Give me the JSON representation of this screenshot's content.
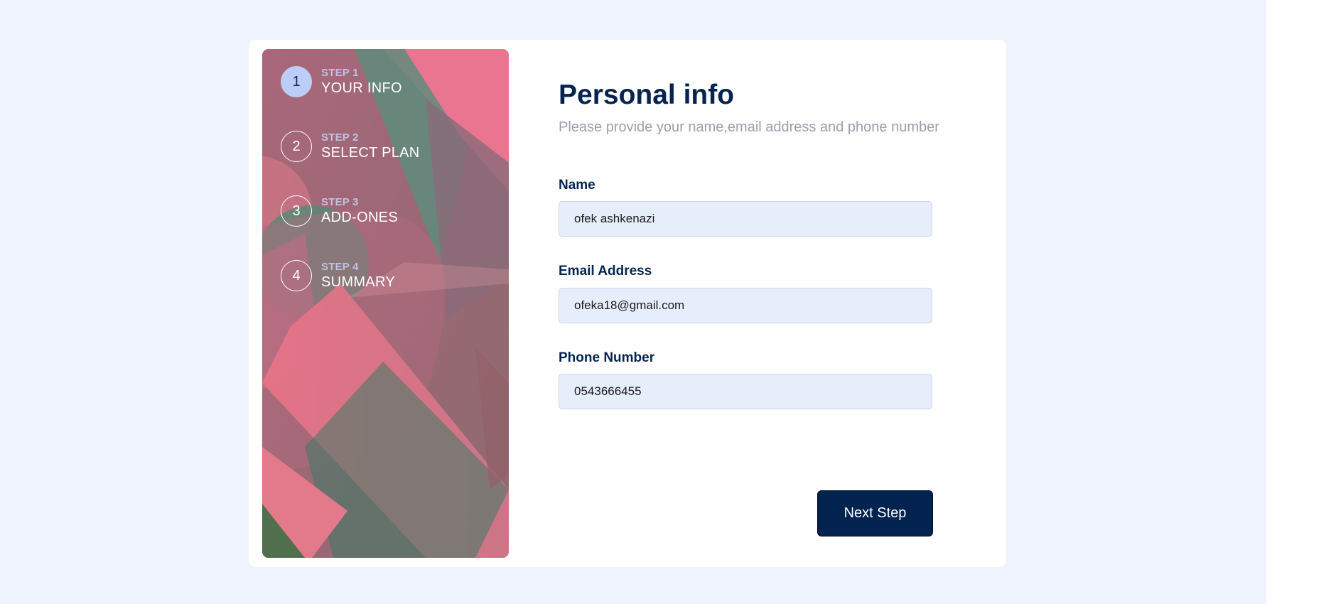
{
  "steps": [
    {
      "number": "1",
      "step_label": "STEP 1",
      "title": "YOUR INFO",
      "active": true
    },
    {
      "number": "2",
      "step_label": "STEP 2",
      "title": "SELECT PLAN",
      "active": false
    },
    {
      "number": "3",
      "step_label": "STEP 3",
      "title": "ADD-ONES",
      "active": false
    },
    {
      "number": "4",
      "step_label": "STEP 4",
      "title": "SUMMARY",
      "active": false
    }
  ],
  "form": {
    "title": "Personal info",
    "subtitle": "Please provide your name,email address and phone number",
    "fields": [
      {
        "label": "Name",
        "value": "ofek ashkenazi"
      },
      {
        "label": "Email Address",
        "value": "ofeka18@gmail.com"
      },
      {
        "label": "Phone Number",
        "value": "0543666455"
      }
    ],
    "next_button": "Next Step"
  },
  "colors": {
    "page_background": "#eef3fd",
    "card_background": "#ffffff",
    "heading": "#04244f",
    "button": "#02234f",
    "active_step": "#bccdf7",
    "input_background": "#e7eefb"
  }
}
